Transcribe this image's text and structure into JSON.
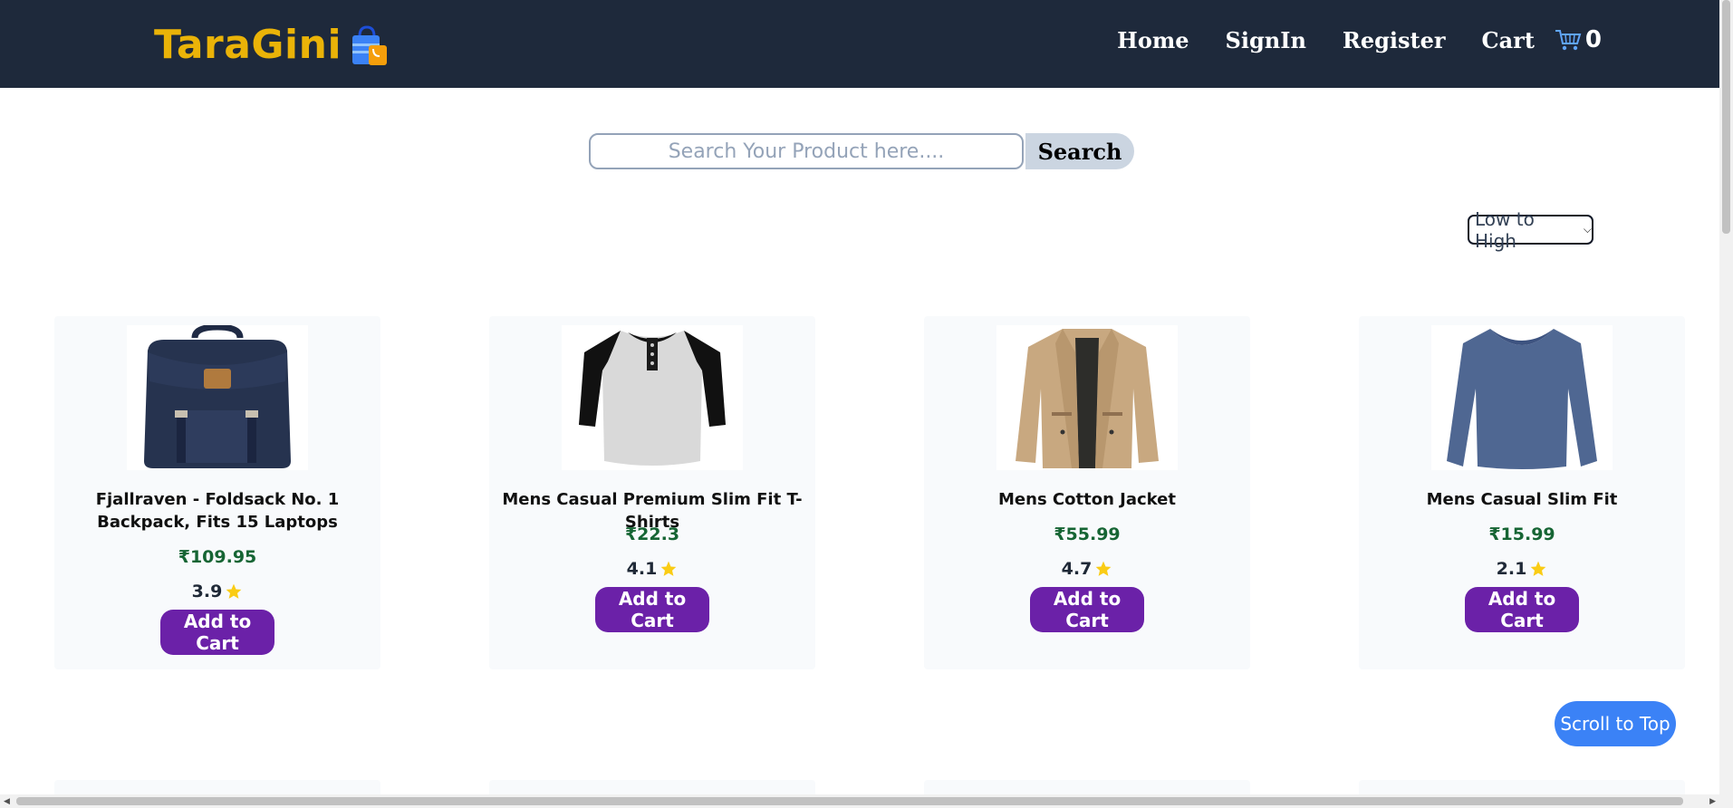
{
  "header": {
    "logo_text": "TaraGini",
    "nav": [
      "Home",
      "SignIn",
      "Register",
      "Cart"
    ],
    "cart_count": "0"
  },
  "search": {
    "placeholder": "Search Your Product here....",
    "value": "",
    "button_label": "Search"
  },
  "sort": {
    "selected": "Low to High"
  },
  "products": [
    {
      "title": "Fjallraven - Foldsack No. 1 Backpack, Fits 15 Laptops",
      "price": "₹109.95",
      "rating": "3.9",
      "button": "Add to Cart",
      "icon": "backpack-image"
    },
    {
      "title": "Mens Casual Premium Slim Fit T-Shirts",
      "price": "₹22.3",
      "rating": "4.1",
      "button": "Add to Cart",
      "icon": "tshirt-image"
    },
    {
      "title": "Mens Cotton Jacket",
      "price": "₹55.99",
      "rating": "4.7",
      "button": "Add to Cart",
      "icon": "jacket-image"
    },
    {
      "title": "Mens Casual Slim Fit",
      "price": "₹15.99",
      "rating": "2.1",
      "button": "Add to Cart",
      "icon": "longsleeve-image"
    }
  ],
  "scroll_top_label": "Scroll to Top",
  "colors": {
    "navbar": "#1e293b",
    "logo": "#eab308",
    "price": "#166534",
    "add_button": "#6b21a8",
    "scroll_button": "#3b82f6",
    "star": "#facc15"
  }
}
